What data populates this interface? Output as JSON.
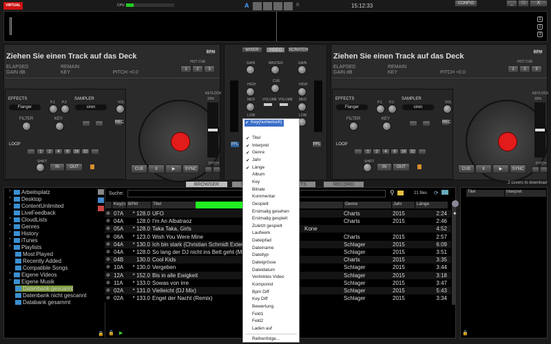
{
  "app": {
    "logo": "VIRTUAL DJ",
    "cpu_label": "CPU",
    "cpu_level": 0.15,
    "deck_a": "A",
    "deck_b": "B",
    "clock": "15:12:33",
    "config": "CONFIG",
    "minimize": "_",
    "maximize": "□",
    "close": "X"
  },
  "waveform": {
    "zoom_buttons": [
      "1",
      "2",
      "3"
    ]
  },
  "decks": [
    {
      "title": "Ziehen Sie einen Track auf das Deck",
      "bpm_btn": "BPM",
      "elapsed": "ELAPSED",
      "remain": "REMAIN",
      "gain": "GAIN dB",
      "key": "KEY",
      "pitch": "PITCH +0.0",
      "hotcue_label": "HOT CUE",
      "hotcues": [
        "1",
        "2",
        "3"
      ],
      "effects_label": "EFFECTS",
      "effect": "Flanger",
      "p1": "P.1",
      "p2": "P.2",
      "filter": "FILTER",
      "key_knob": "KEY",
      "sampler_label": "SAMPLER",
      "sample": "siren",
      "vol": "VOL",
      "rec": "REC",
      "loop_label": "LOOP",
      "loops": [
        "1",
        "2",
        "4",
        "8",
        "16",
        "32"
      ],
      "shift": "SHIFT",
      "in": "IN",
      "out": "OUT",
      "keylock": "KEYLOCK",
      "pitch_range": "33%",
      "pitch_label": "PITCH",
      "transport": [
        "CUE",
        "II",
        "▶",
        "SYNC"
      ]
    },
    {
      "title": "Ziehen Sie einen Track auf das Deck",
      "bpm_btn": "BPM",
      "elapsed": "ELAPSED",
      "remain": "REMAIN",
      "gain": "GAIN dB",
      "key": "KEY",
      "pitch": "PITCH +0.0",
      "hotcue_label": "HOT CUE",
      "hotcues": [
        "1",
        "2",
        "3"
      ],
      "effects_label": "EFFECTS",
      "effect": "Flanger",
      "p1": "P.1",
      "p2": "P.2",
      "filter": "FILTER",
      "key_knob": "KEY",
      "sampler_label": "SAMPLER",
      "sample": "siren",
      "vol": "VOL",
      "rec": "REC",
      "loop_label": "LOOP",
      "loops": [
        "1",
        "2",
        "4",
        "8",
        "16",
        "32"
      ],
      "shift": "SHIFT",
      "in": "IN",
      "out": "OUT",
      "keylock": "KEYLOCK",
      "pitch_range": "33%",
      "pitch_label": "PITCH",
      "transport": [
        "CUE",
        "II",
        "▶",
        "SYNC"
      ]
    }
  ],
  "mixer": {
    "tabs": [
      "MIXER",
      "VIDEO",
      "SCRATCH"
    ],
    "gain": "GAIN",
    "master": "MASTER",
    "cue": "CUE",
    "high": "HIGH",
    "med": "MED",
    "low": "LOW",
    "volume": "VOLUME",
    "pfl": "PFL"
  },
  "browser_tabs": [
    "BROWSER",
    "SAMPLER",
    "EFFECTS",
    "RECORD"
  ],
  "covers_status": "2 covers to download",
  "tree": [
    "Arbeitsplatz",
    "Desktop",
    "ContentUnlimited",
    "LiveFeedback",
    "CloudLists",
    "Genres",
    "History",
    "iTunes",
    "Playlists",
    "Most Played",
    "Recently Added",
    "Compatible Songs",
    "Eigene Videos",
    "Eigene Musik",
    "Datenbank gescannt",
    "Datenbank nicht gescannt",
    "Databank gesammt"
  ],
  "search": {
    "label": "Suche:",
    "value": "",
    "file_count": "21 files"
  },
  "columns": {
    "key": "Key(n",
    "bpm": "BPM",
    "title": "Titel",
    "genre": "Genre",
    "year": "Jahr",
    "length": "Länge"
  },
  "tracks": [
    {
      "key": "07A",
      "bpm": "* 128.0",
      "title": "UFO",
      "genre": "Charts",
      "year": "2015",
      "length": "2:24"
    },
    {
      "key": "04A",
      "bpm": "128.0",
      "title": "I'm An Albatraoz",
      "genre": "Charts",
      "year": "2015",
      "length": "2:46"
    },
    {
      "key": "05A",
      "bpm": "* 128.0",
      "title": "Taka Taka, Girls",
      "extra": "Kone",
      "genre": "",
      "year": "",
      "length": "4:52"
    },
    {
      "key": "06A",
      "bpm": "* 123.0",
      "title": "Wish You Were Mine",
      "genre": "Charts",
      "year": "2015",
      "length": "2:57"
    },
    {
      "key": "04A",
      "bpm": "* 130.0",
      "title": "Ich bin stark (Christian Schmidt Extende",
      "genre": "Schlager",
      "year": "2015",
      "length": "6:09"
    },
    {
      "key": "04A",
      "bpm": "* 128.0",
      "title": "So lang der DJ nicht ins Bett geht (Mich",
      "genre": "Schlager",
      "year": "2015",
      "length": "3:51"
    },
    {
      "key": "04B",
      "bpm": "130.0",
      "title": "Cool Kids",
      "genre": "Charts",
      "year": "2015",
      "length": "3:35"
    },
    {
      "key": "10A",
      "bpm": "* 130.0",
      "title": "Vergeben",
      "genre": "Schlager",
      "year": "2015",
      "length": "3:44"
    },
    {
      "key": "12A",
      "bpm": "* 152.0",
      "title": "Bis in alle Ewigkeit",
      "genre": "Schlager",
      "year": "2015",
      "length": "3:18"
    },
    {
      "key": "11A",
      "bpm": "* 133.0",
      "title": "Sowas von irre",
      "genre": "Schlager",
      "year": "2015",
      "length": "3:47"
    },
    {
      "key": "02A",
      "bpm": "* 131.0",
      "title": "Vielleicht (DJ Mix)",
      "genre": "Schlager",
      "year": "2015",
      "length": "5:43"
    },
    {
      "key": "02A",
      "bpm": "* 133.0",
      "title": "Engel der Nacht (Remix)",
      "genre": "Schlager",
      "year": "2015",
      "length": "3:34"
    }
  ],
  "side_list": {
    "columns": [
      "Titel",
      "Interpret"
    ]
  },
  "context_menu": {
    "selected": "Key(numerisch)",
    "items": [
      {
        "label": "Titel",
        "checked": true
      },
      {
        "label": "Interpret",
        "checked": true
      },
      {
        "label": "Genre",
        "checked": true
      },
      {
        "label": "Jahr",
        "checked": true
      },
      {
        "label": "Länge",
        "checked": true
      },
      {
        "label": "Album",
        "checked": false
      },
      {
        "label": "Key",
        "checked": false
      },
      {
        "label": "Bitrate",
        "checked": false
      },
      {
        "label": "Kommentar",
        "checked": false
      },
      {
        "label": "Gespielt",
        "checked": false
      },
      {
        "label": "Erstmalig gesehen",
        "checked": false
      },
      {
        "label": "Erstmalig gespielt",
        "checked": false
      },
      {
        "label": "Zuletzt gespielt",
        "checked": false
      },
      {
        "label": "Laufwerk",
        "checked": false
      },
      {
        "label": "Dateipfad",
        "checked": false
      },
      {
        "label": "Dateiname",
        "checked": false
      },
      {
        "label": "Dateityp",
        "checked": false
      },
      {
        "label": "Dateigrösse",
        "checked": false
      },
      {
        "label": "Dateidatum",
        "checked": false
      },
      {
        "label": "Verlinktes Video",
        "checked": false
      },
      {
        "label": "Komponist",
        "checked": false
      },
      {
        "label": "Bpm Diff",
        "checked": false
      },
      {
        "label": "Key Diff",
        "checked": false
      },
      {
        "label": "Bewertung",
        "checked": false
      },
      {
        "label": "Feld1",
        "checked": false
      },
      {
        "label": "Feld2",
        "checked": false
      },
      {
        "label": "Laden auf",
        "checked": false
      }
    ],
    "footer": "Reihenfolge..."
  },
  "colors": {
    "accent_green": "#22ee22",
    "logo_red": "#cc1111",
    "selection": "#7a9a3a",
    "menu_highlight": "#3a6ec8"
  }
}
